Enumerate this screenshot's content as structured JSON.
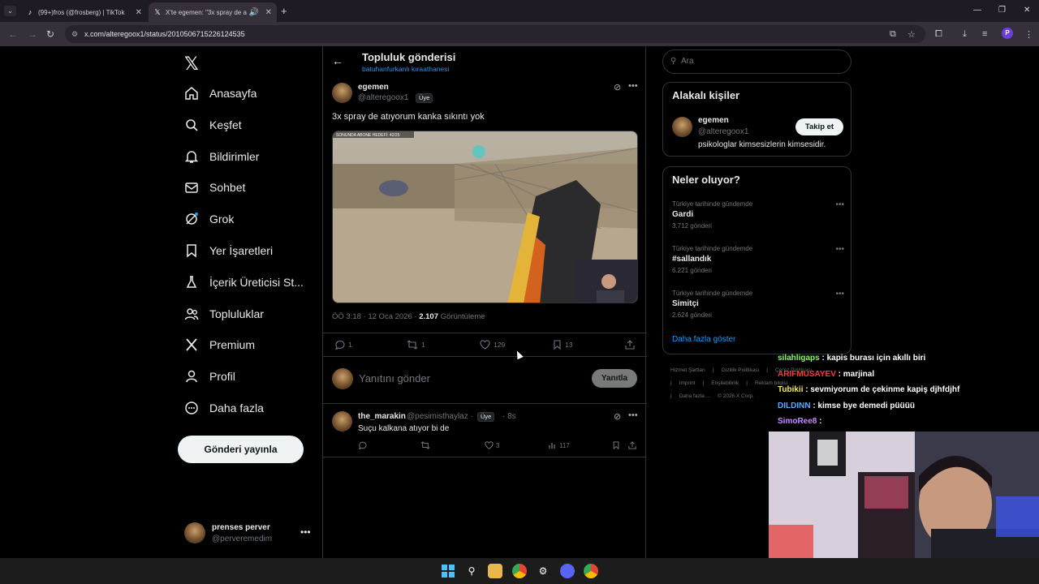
{
  "browser": {
    "tabs": [
      {
        "title": "(99+)fros (@frosberg) | TikTok",
        "icon": "tiktok-icon"
      },
      {
        "title": "X'te egemen: \"3x spray de a",
        "icon": "x-icon"
      }
    ],
    "url": "x.com/alteregoox1/status/2010506715226124535"
  },
  "nav": {
    "items": [
      {
        "label": "Anasayfa",
        "icon": "home-icon"
      },
      {
        "label": "Keşfet",
        "icon": "search-icon"
      },
      {
        "label": "Bildirimler",
        "icon": "bell-icon"
      },
      {
        "label": "Sohbet",
        "icon": "mail-icon"
      },
      {
        "label": "Grok",
        "icon": "grok-icon"
      },
      {
        "label": "Yer İşaretleri",
        "icon": "bookmark-icon"
      },
      {
        "label": "İçerik Üreticisi St...",
        "icon": "flask-icon"
      },
      {
        "label": "Topluluklar",
        "icon": "people-icon"
      },
      {
        "label": "Premium",
        "icon": "x-icon"
      },
      {
        "label": "Profil",
        "icon": "person-icon"
      },
      {
        "label": "Daha fazla",
        "icon": "more-circle-icon"
      }
    ],
    "post_button": "Gönderi yayınla",
    "account": {
      "name": "prenses perver",
      "handle": "@perveremedim"
    }
  },
  "header": {
    "title": "Topluluk gönderisi",
    "subtitle": "batuhanfurkanlı kıraathanesi"
  },
  "tweet": {
    "author": "egemen",
    "handle": "@alteregoox1",
    "badge": "Üye",
    "text": "3x spray de atıyorum kanka sıkıntı yok",
    "media_overlay": "SONUNDA ABONE HEDEFİ: 42/25",
    "time": "ÖÖ 3:18 · 12 Oca 2026 ·",
    "views": "2.107",
    "views_label": "Görüntüleme",
    "replies": "1",
    "reposts": "1",
    "likes": "129",
    "bookmarks": "13"
  },
  "reply_box": {
    "placeholder": "Yanıtını gönder",
    "button": "Yanıtla"
  },
  "reply": {
    "author": "the_marakin",
    "handle": "@pesimisthaylaz ·",
    "badge": "Üye",
    "time": "· 8s",
    "text": "Suçu kalkana atıyor bi de",
    "reposts": "",
    "likes": "3",
    "views": "117"
  },
  "search": {
    "placeholder": "Ara"
  },
  "people": {
    "title": "Alakalı kişiler",
    "name": "egemen",
    "handle": "@alteregoox1",
    "bio": "psikologlar kimsesizlerin kimsesidir.",
    "follow": "Takip et"
  },
  "trends": {
    "title": "Neler oluyor?",
    "items": [
      {
        "category": "Türkiye tarihinde gündemde",
        "name": "Gardi",
        "count": "3.712 gönderi"
      },
      {
        "category": "Türkiye tarihinde gündemde",
        "name": "#sallandık",
        "count": "6.221 gönderi"
      },
      {
        "category": "Türkiye tarihinde gündemde",
        "name": "Simitçi",
        "count": "2.624 gönderi"
      }
    ],
    "show_more": "Daha fazla göster"
  },
  "footer": {
    "links": [
      "Hizmet Şartları",
      "|",
      "Gizlilik Politikası",
      "|",
      "Çerez Politikası",
      "|",
      "Imprint",
      "|",
      "Erişilebilirlik",
      "|",
      "Reklam bilgisi",
      "|",
      "Daha fazla ...",
      "© 2026 X Corp."
    ]
  },
  "chat": [
    {
      "user": "silahligaps",
      "color": "#7dff5a",
      "msg": ": kapis burası için akıllı biri"
    },
    {
      "user": "ARIFMUSAYEV",
      "color": "#ff3b3b",
      "msg": ": marjinal"
    },
    {
      "user": "Tubikii",
      "color": "#f5e663",
      "msg": ": sevmiyorum de çekinme kapiş djhfdjhf"
    },
    {
      "user": "DILDINN",
      "color": "#5fa8ff",
      "msg": ": kimse bye demedi püüüü"
    },
    {
      "user": "SimoRee8",
      "color": "#c68bff",
      "msg": ":"
    }
  ],
  "colors": {
    "accent": "#1d9bf0",
    "border": "#2f3336",
    "muted": "#71767b"
  }
}
